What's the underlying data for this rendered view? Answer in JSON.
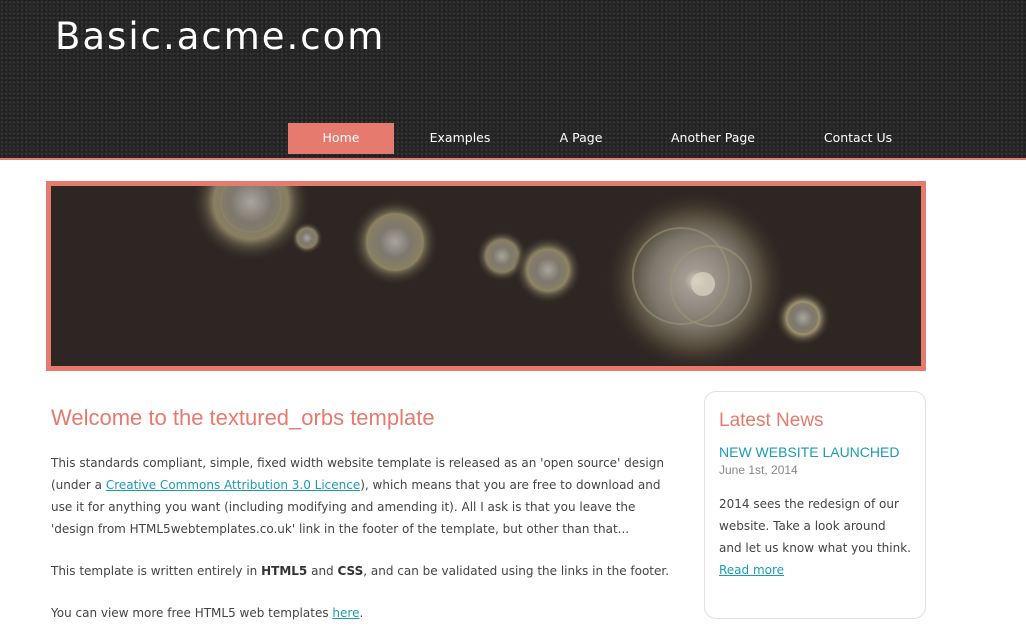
{
  "site": {
    "logo": "Basic.acme.com"
  },
  "menu": {
    "items": [
      {
        "label": "Home",
        "active": true
      },
      {
        "label": "Examples",
        "active": false
      },
      {
        "label": "A Page",
        "active": false
      },
      {
        "label": "Another Page",
        "active": false
      },
      {
        "label": "Contact Us",
        "active": false
      }
    ]
  },
  "colors": {
    "accent": "#e77a6e",
    "link": "#1b9bb5",
    "header_bg": "#262626",
    "banner_bg": "#2e2622"
  },
  "main": {
    "heading": "Welcome to the textured_orbs template",
    "p1": {
      "before": "This standards compliant, simple, fixed width website template is released as an 'open source' design (under a ",
      "link": "Creative Commons Attribution 3.0 Licence",
      "after": "), which means that you are free to download and use it for anything you want (including modifying and amending it). All I ask is that you leave the 'design from HTML5webtemplates.co.uk' link in the footer of the template, but other than that..."
    },
    "p2": {
      "before": "This template is written entirely in ",
      "bold1": "HTML5",
      "mid": " and ",
      "bold2": "CSS",
      "after": ", and can be validated using the links in the footer."
    },
    "p3": {
      "before": "You can view more free HTML5 web templates ",
      "link": "here",
      "after": "."
    }
  },
  "sidebar": {
    "title": "Latest News",
    "news_title": "NEW WEBSITE LAUNCHED",
    "news_date": "June 1st, 2014",
    "news_body": "2014 sees the redesign of our website. Take a look around and let us know what you think.",
    "read_more": "Read more"
  }
}
